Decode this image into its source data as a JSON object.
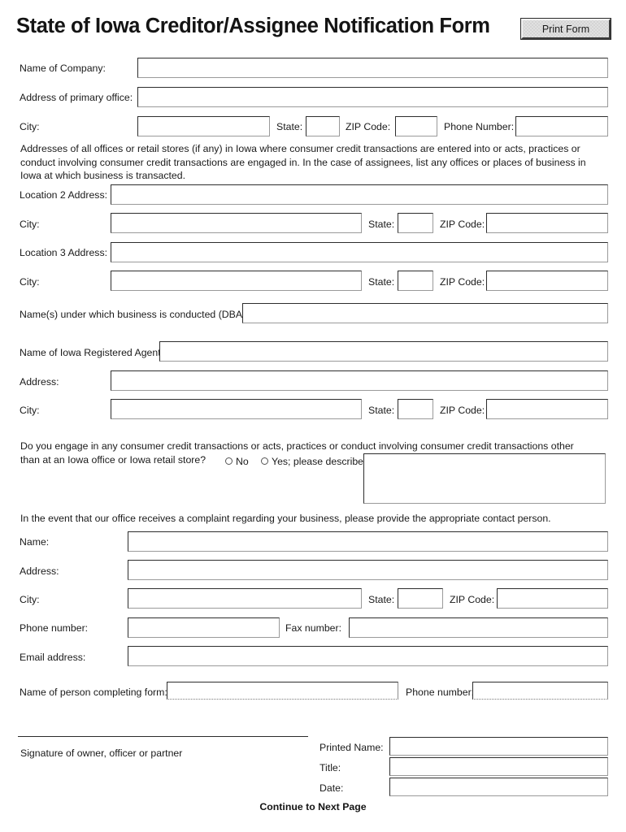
{
  "header": {
    "title": "State of Iowa Creditor/Assignee Notification Form",
    "print_button": "Print Form"
  },
  "company_section": {
    "name_label": "Name of Company:",
    "name_value": "",
    "address_label": "Address of primary office:",
    "address_value": "",
    "city_label": "City:",
    "city_value": "",
    "state_label": "State:",
    "state_value": "",
    "zip_label": "ZIP Code:",
    "zip_value": "",
    "phone_label": "Phone Number:",
    "phone_value": ""
  },
  "locations_section": {
    "instructions": "Addresses of all offices or retail stores (if any) in Iowa where consumer credit transactions are entered into or acts, practices or conduct  involving consumer credit transactions are engaged in.  In the case of assignees, list any offices or places of business in Iowa at which business is transacted.",
    "location2_label": "Location 2 Address:",
    "location2_value": "",
    "location2_city_label": "City:",
    "location2_city_value": "",
    "location2_state_label": "State:",
    "location2_state_value": "",
    "location2_zip_label": "ZIP Code:",
    "location2_zip_value": "",
    "location3_label": "Location 3 Address:",
    "location3_value": "",
    "location3_city_label": "City:",
    "location3_city_value": "",
    "location3_state_label": "State:",
    "location3_state_value": "",
    "location3_zip_label": "ZIP Code:",
    "location3_zip_value": ""
  },
  "dba_section": {
    "label": "Name(s) under which business is conducted (DBAs):",
    "value": ""
  },
  "agent_section": {
    "name_label": "Name of Iowa Registered Agent:",
    "name_value": "",
    "address_label": "Address:",
    "address_value": "",
    "city_label": "City:",
    "city_value": "",
    "state_label": "State:",
    "state_value": "",
    "zip_label": "ZIP Code:",
    "zip_value": ""
  },
  "engage_question": {
    "text_line1": "Do you engage in any consumer credit transactions or acts, practices or conduct involving consumer credit transactions other",
    "text_line2": "than at an Iowa office or Iowa retail store?",
    "option_no": "No",
    "option_yes": "Yes; please describe",
    "selected": "",
    "describe_value": ""
  },
  "complaint_section": {
    "intro": "In the event that our office receives a complaint regarding your business, please provide the appropriate contact person.",
    "name_label": "Name:",
    "name_value": "",
    "address_label": "Address:",
    "address_value": "",
    "city_label": "City:",
    "city_value": "",
    "state_label": "State:",
    "state_value": "",
    "zip_label": "ZIP Code:",
    "zip_value": "",
    "phone_label": "Phone number:",
    "phone_value": "",
    "fax_label": "Fax number:",
    "fax_value": "",
    "email_label": "Email address:",
    "email_value": ""
  },
  "completer_section": {
    "name_label": "Name of person completing form:",
    "name_value": "",
    "phone_label": "Phone number:",
    "phone_value": ""
  },
  "signature_section": {
    "signature_caption": "Signature of owner, officer or partner",
    "printed_name_label": "Printed Name:",
    "printed_name_value": "",
    "title_label": "Title:",
    "title_value": "",
    "date_label": "Date:",
    "date_value": ""
  },
  "footer": {
    "continue_note": "Continue to Next Page"
  }
}
